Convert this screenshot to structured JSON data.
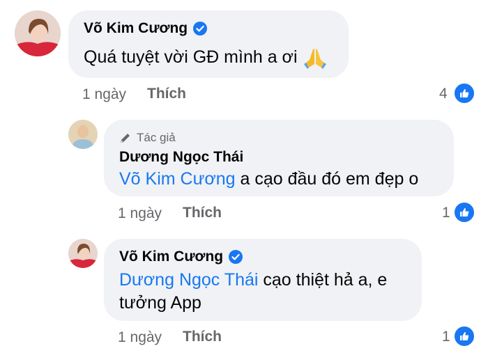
{
  "comments": [
    {
      "author": "Võ Kim Cương",
      "verified": true,
      "body": "Quá tuyệt vời GĐ mình a ơi",
      "emoji": "folded-hands",
      "time": "1 ngày",
      "like_label": "Thích",
      "like_count": "4"
    },
    {
      "author_tag": "Tác giả",
      "author": "Dương Ngọc Thái",
      "verified": false,
      "mention": "Võ Kim Cương",
      "body": " a cạo đầu đó em đẹp o",
      "time": "1 ngày",
      "like_label": "Thích",
      "like_count": "1"
    },
    {
      "author": "Võ Kim Cương",
      "verified": true,
      "mention": "Dương Ngọc Thái",
      "body_line1": " cạo thiệt hả a, e",
      "body_line2": "tưởng App",
      "time": "1 ngày",
      "like_label": "Thích",
      "like_count": "1"
    }
  ],
  "colors": {
    "accent": "#1877f2",
    "bubble": "#f0f2f5",
    "meta": "#65676b"
  }
}
